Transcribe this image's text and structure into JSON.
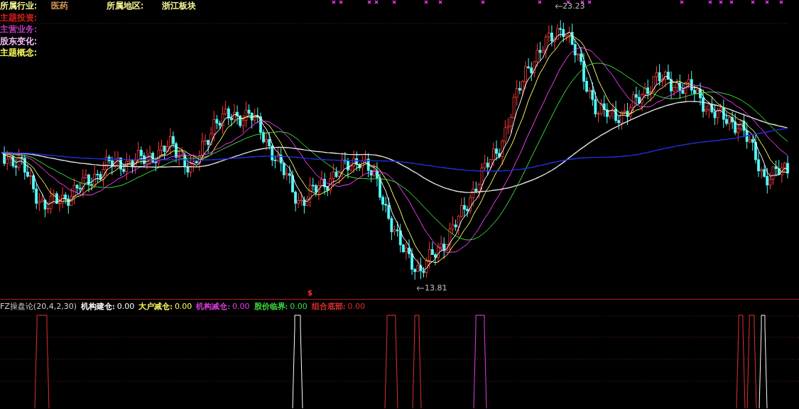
{
  "info_panel": {
    "rows": [
      {
        "items": [
          {
            "text": "所属行业:",
            "color": "#ffff99"
          },
          {
            "text": "医药",
            "color": "#e8a060"
          },
          {
            "text": "所属地区:",
            "color": "#ffff99"
          },
          {
            "text": "浙江板块",
            "color": "#ffff99"
          }
        ]
      },
      {
        "items": [
          {
            "text": "主题投资:",
            "color": "#e02020"
          }
        ]
      },
      {
        "items": [
          {
            "text": "主营业务:",
            "color": "#c040c0"
          }
        ]
      },
      {
        "items": [
          {
            "text": "股东变化:",
            "color": "#ffc0ff"
          }
        ]
      },
      {
        "items": [
          {
            "text": "主题概念:",
            "color": "#ffff60"
          }
        ]
      }
    ]
  },
  "price_chart": {
    "high_label": "23.23",
    "low_label": "13.81"
  },
  "signal_mark": "$",
  "indicator": {
    "name": "FZ操盘论(20,4,2,30)",
    "series": [
      {
        "label": "机构建仓:",
        "value": "0.00",
        "color": "#ffffff"
      },
      {
        "label": "大户减仓:",
        "value": "0.00",
        "color": "#ffff60"
      },
      {
        "label": "机构减仓:",
        "value": "0.00",
        "color": "#e040e0"
      },
      {
        "label": "股价临界:",
        "value": "0.00",
        "color": "#40e040"
      },
      {
        "label": "组合底部:",
        "value": "0.00",
        "color": "#e03030"
      }
    ]
  }
}
